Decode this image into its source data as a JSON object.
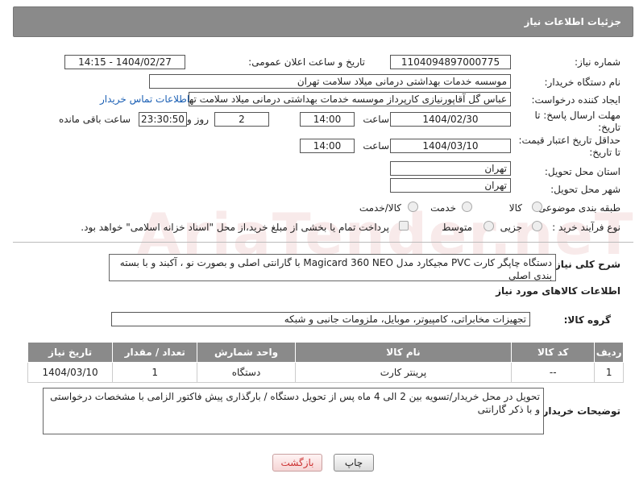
{
  "header": {
    "title": "جزئیات اطلاعات نیاز"
  },
  "form": {
    "need_number": {
      "label": "شماره نیاز:",
      "value": "1104094897000775"
    },
    "announce": {
      "label": "تاریخ و ساعت اعلان عمومی:",
      "value": "1404/02/27 - 14:15"
    },
    "buyer_org": {
      "label": "نام دستگاه خریدار:",
      "value": "موسسه خدمات بهداشتی درمانی میلاد سلامت تهران"
    },
    "creator": {
      "label": "ایجاد کننده درخواست:",
      "value": "عباس گل آقاپورنیازی کارپرداز موسسه خدمات بهداشتی درمانی میلاد سلامت تهران",
      "link": "اطلاعات تماس خریدار"
    },
    "reply_deadline": {
      "label1": "مهلت ارسال پاسخ: تا",
      "label2": "تاریخ:",
      "date": "1404/02/30",
      "time_label": "ساعت",
      "time": "14:00",
      "days": "2",
      "days_label": "روز و",
      "remaining": "23:30:50",
      "remaining_label": "ساعت باقی مانده"
    },
    "price_validity": {
      "label1": "حداقل تاریخ اعتبار قیمت:",
      "label2": "تا تاریخ:",
      "date": "1404/03/10",
      "time_label": "ساعت",
      "time": "14:00"
    },
    "province": {
      "label": "استان محل تحویل:",
      "value": "تهران"
    },
    "city": {
      "label": "شهر محل تحویل:",
      "value": "تهران"
    },
    "category": {
      "label": "طبقه بندی موضوعی:",
      "options": [
        "کالا",
        "خدمت",
        "کالا/خدمت"
      ]
    },
    "process": {
      "label": "نوع فرآیند خرید :",
      "options": [
        "جزیی",
        "متوسط"
      ],
      "payment_note": "پرداخت تمام یا بخشی از مبلغ خرید،از محل \"اسناد خزانه اسلامی\" خواهد بود."
    }
  },
  "description": {
    "label": "شرح کلی نیاز:",
    "value": "دستگاه چاپگر کارت PVC مجیکارد مدل Magicard 360 NEO با گارانتی اصلی و بصورت نو ، آکبند و با بسته بندی اصلی"
  },
  "goods_section": {
    "title": "اطلاعات کالاهای مورد نیاز"
  },
  "goods_group": {
    "label": "گروه کالا:",
    "value": "تجهیزات مخابراتی، کامپیوتر، موبایل، ملزومات جانبی و شبکه"
  },
  "table": {
    "headers": [
      "ردیف",
      "کد کالا",
      "نام کالا",
      "واحد شمارش",
      "تعداد / مقدار",
      "تاریخ نیاز"
    ],
    "rows": [
      [
        "1",
        "--",
        "پرینتر کارت",
        "دستگاه",
        "1",
        "1404/03/10"
      ]
    ]
  },
  "buyer_notes": {
    "label": "توضیحات خریدار:",
    "value": "تحویل در محل خریدار/تسویه بین 2 الی 4 ماه پس از تحویل دستگاه / بارگذاری پیش فاکتور الزامی با مشخصات درخواستی و با ذکر گارانتی"
  },
  "buttons": {
    "print": "چاپ",
    "back": "بازگشت"
  },
  "watermark": "AriaTender.neT"
}
